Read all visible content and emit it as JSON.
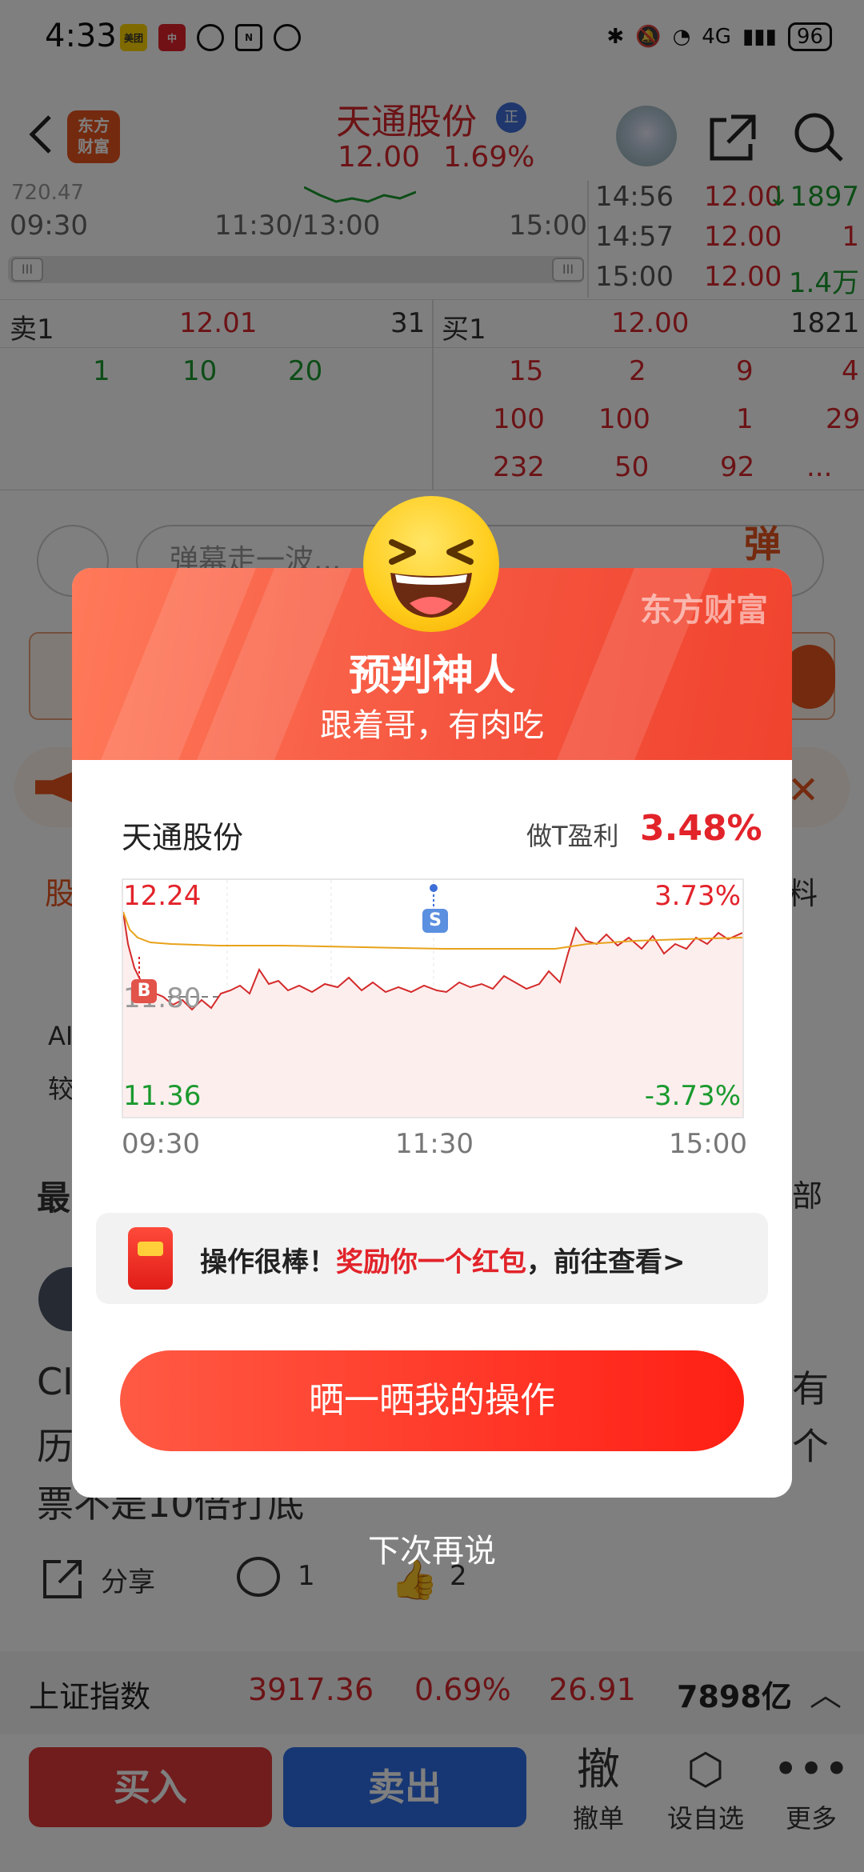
{
  "status": {
    "time": "4:33",
    "battery": "96",
    "network": "4G"
  },
  "header": {
    "logo": "东方\n财富",
    "title": "天通股份",
    "badge": "正",
    "price": "12.00",
    "change": "1.69%"
  },
  "mini_chart": {
    "partial_value": "720.47",
    "times": [
      "09:30",
      "11:30/13:00",
      "15:00"
    ]
  },
  "trades": [
    {
      "time": "14:56",
      "price": "12.00",
      "vol": "↓1897"
    },
    {
      "time": "14:57",
      "price": "12.00",
      "vol": "1"
    },
    {
      "time": "15:00",
      "price": "12.00",
      "vol": "1.4万"
    }
  ],
  "order_book": {
    "sell": {
      "label": "卖1",
      "price": "12.01",
      "vol": "31",
      "row2": [
        "1",
        "10",
        "20"
      ]
    },
    "buy": {
      "label": "买1",
      "price": "12.00",
      "vol": "1821",
      "rows": [
        [
          "15",
          "2",
          "9",
          "4"
        ],
        [
          "100",
          "100",
          "1",
          "29"
        ],
        [
          "232",
          "50",
          "92",
          "..."
        ]
      ]
    }
  },
  "danmu": {
    "placeholder": "弹幕走一波...",
    "button": "弹"
  },
  "background": {
    "section": "最",
    "tab_left": "股",
    "tab_right": "料",
    "ai_label": "AI",
    "compare": "较",
    "all": "部",
    "post_line1_left": "CI",
    "post_line1_right": "有",
    "post_line2_left": "历",
    "post_line2_right": "个",
    "post_line3": "票不是10倍打底",
    "share": "分享",
    "comments": "1",
    "likes": "2"
  },
  "dialog": {
    "brand": "东方财富",
    "title": "预判神人",
    "subtitle": "跟着哥，有肉吃",
    "stock_name": "天通股份",
    "profit_label": "做T盈利",
    "profit_value": "3.48%",
    "y_max": "12.24",
    "y_mid": "11.80",
    "y_min": "11.36",
    "pct_max": "3.73%",
    "pct_min": "-3.73%",
    "x_start": "09:30",
    "x_mid": "11:30",
    "x_end": "15:00",
    "buy_marker": "B",
    "sell_marker": "S",
    "reward_prefix": "操作很棒！",
    "reward_highlight": "奖励你一个红包",
    "reward_suffix": "，前往查看>",
    "share_button": "晒一晒我的操作",
    "later": "下次再说"
  },
  "quote_bar": {
    "name": "上证指数",
    "value": "3917.36",
    "pct": "0.69%",
    "change": "26.91",
    "volume": "7898亿"
  },
  "bottom": {
    "buy": "买入",
    "sell": "卖出",
    "cancel_icon": "撤",
    "cancel": "撤单",
    "watch": "设自选",
    "more": "更多"
  },
  "colors": {
    "accent_red": "#e2232a",
    "down_green": "#1a9a2e",
    "brand_orange": "#e9541e"
  }
}
